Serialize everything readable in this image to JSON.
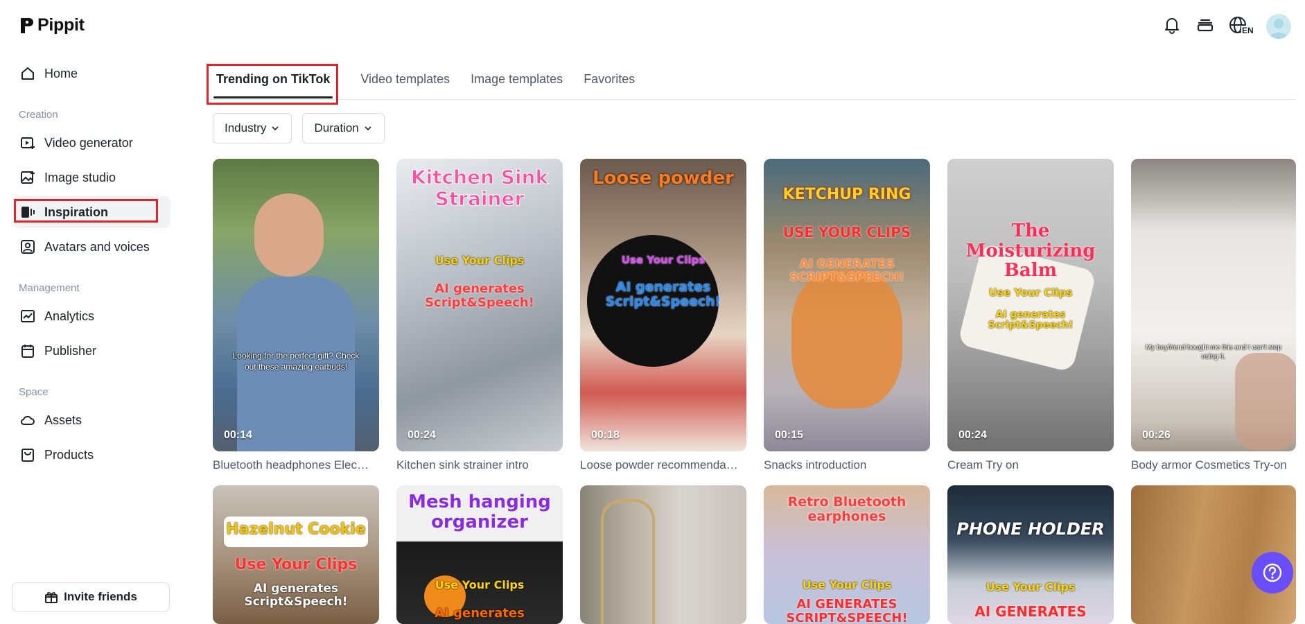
{
  "app": {
    "name": "Pippit"
  },
  "sidebar": {
    "home": "Home",
    "sections": {
      "creation": "Creation",
      "management": "Management",
      "space": "Space"
    },
    "items": [
      {
        "label": "Video generator",
        "icon": "video-plus-icon"
      },
      {
        "label": "Image studio",
        "icon": "image-plus-icon"
      },
      {
        "label": "Inspiration",
        "icon": "inspiration-icon",
        "active": true
      },
      {
        "label": "Avatars and voices",
        "icon": "avatar-icon"
      },
      {
        "label": "Analytics",
        "icon": "analytics-icon"
      },
      {
        "label": "Publisher",
        "icon": "calendar-icon"
      },
      {
        "label": "Assets",
        "icon": "cloud-icon"
      },
      {
        "label": "Products",
        "icon": "bag-icon"
      }
    ],
    "invite": "Invite friends"
  },
  "header": {
    "language": "EN"
  },
  "tabs": [
    {
      "label": "Trending on TikTok",
      "active": true
    },
    {
      "label": "Video templates"
    },
    {
      "label": "Image templates"
    },
    {
      "label": "Favorites"
    }
  ],
  "filters": {
    "industry": "Industry",
    "duration": "Duration"
  },
  "cards_row1": [
    {
      "duration": "00:14",
      "caption": "Bluetooth headphones Elec…",
      "overlay": "Looking for the perfect gift? Check out these amazing earbuds!"
    },
    {
      "duration": "00:24",
      "caption": "Kitchen sink strainer intro",
      "title": "Kitchen Sink Strainer",
      "line1": "Use Your Clips",
      "line2": "AI generates Script&Speech!"
    },
    {
      "duration": "00:18",
      "caption": "Loose powder recommenda…",
      "title": "Loose powder",
      "line1": "Use Your Clips",
      "line2": "AI generates Script&Speech!"
    },
    {
      "duration": "00:15",
      "caption": "Snacks introduction",
      "title": "KETCHUP RING",
      "line1": "USE YOUR CLIPS",
      "line2": "AI GENERATES SCRIPT&SPEECH!"
    },
    {
      "duration": "00:24",
      "caption": "Cream Try on",
      "title": "The Moisturizing Balm",
      "line1": "Use Your Clips",
      "line2": "AI generates Script&Speech!"
    },
    {
      "duration": "00:26",
      "caption": "Body armor Cosmetics Try-on",
      "overlay": "My boyfriend bought me this and I can't stop using it."
    }
  ],
  "cards_row2": [
    {
      "title": "Hazelnut Cookie",
      "line1": "Use Your Clips",
      "line2": "AI generates Script&Speech!"
    },
    {
      "title": "Mesh hanging organizer",
      "line1": "Use Your Clips",
      "line2": "AI generates"
    },
    {
      "title": ""
    },
    {
      "title": "Retro Bluetooth earphones",
      "line1": "Use Your Clips",
      "line2": "AI GENERATES SCRIPT&SPEECH!"
    },
    {
      "title": "PHONE HOLDER",
      "line1": "Use Your Clips",
      "line2": "AI GENERATES"
    },
    {
      "title": ""
    }
  ]
}
